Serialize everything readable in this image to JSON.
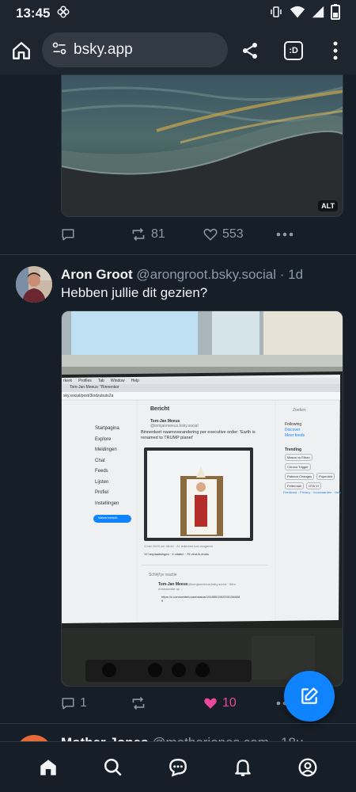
{
  "status_bar": {
    "time": "13:45"
  },
  "browser": {
    "url": "bsky.app",
    "tab_badge": ":D"
  },
  "post1": {
    "alt_label": "ALT",
    "reposts": "81",
    "likes": "553"
  },
  "post2": {
    "author_name": "Aron Groot",
    "author_handle": "@arongroot.bsky.social",
    "time": "· 1d",
    "text": "Hebben jullie dit gezien?",
    "replies": "1",
    "likes": "10",
    "screen": {
      "menu": [
        "rkerk",
        "Profiles",
        "Tab",
        "Window",
        "Help"
      ],
      "tab_title": "Tom-Jan Meeus: \"Binnenkor",
      "address": "sky.social/post/3lodzubuts2a",
      "back_label": "Bericht",
      "search": "Zoeken",
      "nav": [
        "Startpagina",
        "Explore",
        "Meldingen",
        "Chat",
        "Feeds",
        "Lijsten",
        "Profiel",
        "Instellingen"
      ],
      "new_post": "Nieuw bericht",
      "post_author": "Tom-Jan Meeus",
      "post_handle": "@tomjanmeeus.bsky.social",
      "post_text": "Binnenkort naamsverandering per executive order: 'Earth is renamed to TRUMP planet'",
      "post_date": "3 mei 2025 om 08:44 · 21 iedereen kan reageren",
      "post_stats": "12 herplaatsingen · 4 citaten · 76 vind-ik-leuks",
      "feeds_list": [
        "Following",
        "Discover",
        "Meer feeds"
      ],
      "trending_label": "Trending",
      "trending": [
        "Mason vs Ethan",
        "Chrono Trigger",
        "Patreon Changes",
        "Popeutch",
        "Fetterman",
        "GTA VI"
      ],
      "footer": "Feedback · Privacy · Voorwaarden · Help",
      "reply_placeholder": "Schrijf je reactie",
      "reply_author": "Tom-Jan Meeus",
      "reply_handle": "@tomjanmeeus.bsky.social · 58m",
      "reply_sub": "Antwoordde op ...",
      "reply_link": "https://x.com/whitehouse/status/19185515923351348089"
    }
  },
  "post3": {
    "author_name": "Mother Jones",
    "author_handle": "@motherjones.com",
    "time": "· 18u"
  },
  "colors": {
    "accent": "#1083fe",
    "like_pink": "#ec4899",
    "background": "#161e27",
    "muted": "#8c99a8"
  }
}
